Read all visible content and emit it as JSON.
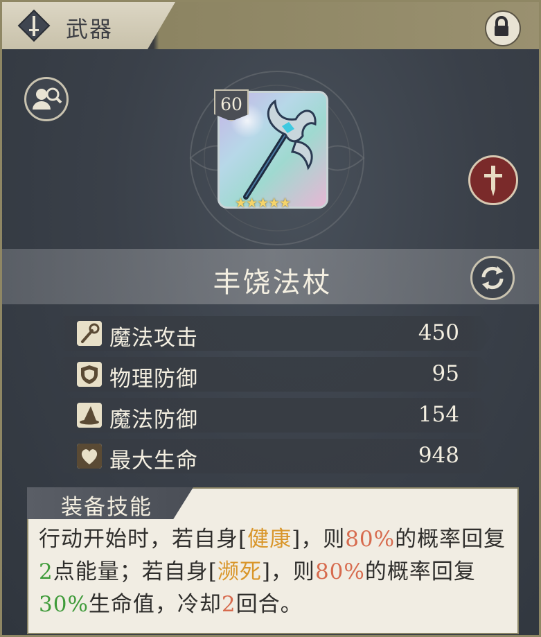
{
  "header": {
    "title": "武器",
    "tab_icon": "sword-diamond-icon",
    "lock_icon": "lock-icon"
  },
  "toolbar": {
    "inspect_icon": "inspect-character-icon",
    "refresh_icon": "switch-arrows-icon",
    "type_icon": "sword-class-icon"
  },
  "weapon": {
    "level": "60",
    "stars": "★★★★★",
    "star_count": 5,
    "name": "丰饶法杖"
  },
  "stats": [
    {
      "label": "魔法攻击",
      "value": "450",
      "icon": "magic-wand-icon"
    },
    {
      "label": "物理防御",
      "value": "95",
      "icon": "shield-icon"
    },
    {
      "label": "魔法防御",
      "value": "154",
      "icon": "wizard-hat-icon"
    },
    {
      "label": "最大生命",
      "value": "948",
      "icon": "heart-icon"
    }
  ],
  "skill": {
    "title": "装备技能",
    "parts": [
      {
        "text": "行动开始时，若自身[",
        "style": "plain"
      },
      {
        "text": "健康",
        "style": "gold"
      },
      {
        "text": "]，则",
        "style": "plain"
      },
      {
        "text": "80%",
        "style": "red"
      },
      {
        "text": "的概率回复",
        "style": "plain"
      },
      {
        "text": "2",
        "style": "green"
      },
      {
        "text": "点能量；若自身[",
        "style": "plain"
      },
      {
        "text": "濒死",
        "style": "gold"
      },
      {
        "text": "]，则",
        "style": "plain"
      },
      {
        "text": "80%",
        "style": "red"
      },
      {
        "text": "的概率回复",
        "style": "plain"
      },
      {
        "text": "30%",
        "style": "green"
      },
      {
        "text": "生命值，冷却",
        "style": "plain"
      },
      {
        "text": "2",
        "style": "red"
      },
      {
        "text": "回合。",
        "style": "plain"
      }
    ]
  },
  "colors": {
    "accent_gold": "#d9962a",
    "accent_red": "#d76b4e",
    "accent_green": "#3f9b3a",
    "frame": "#8f8764"
  }
}
